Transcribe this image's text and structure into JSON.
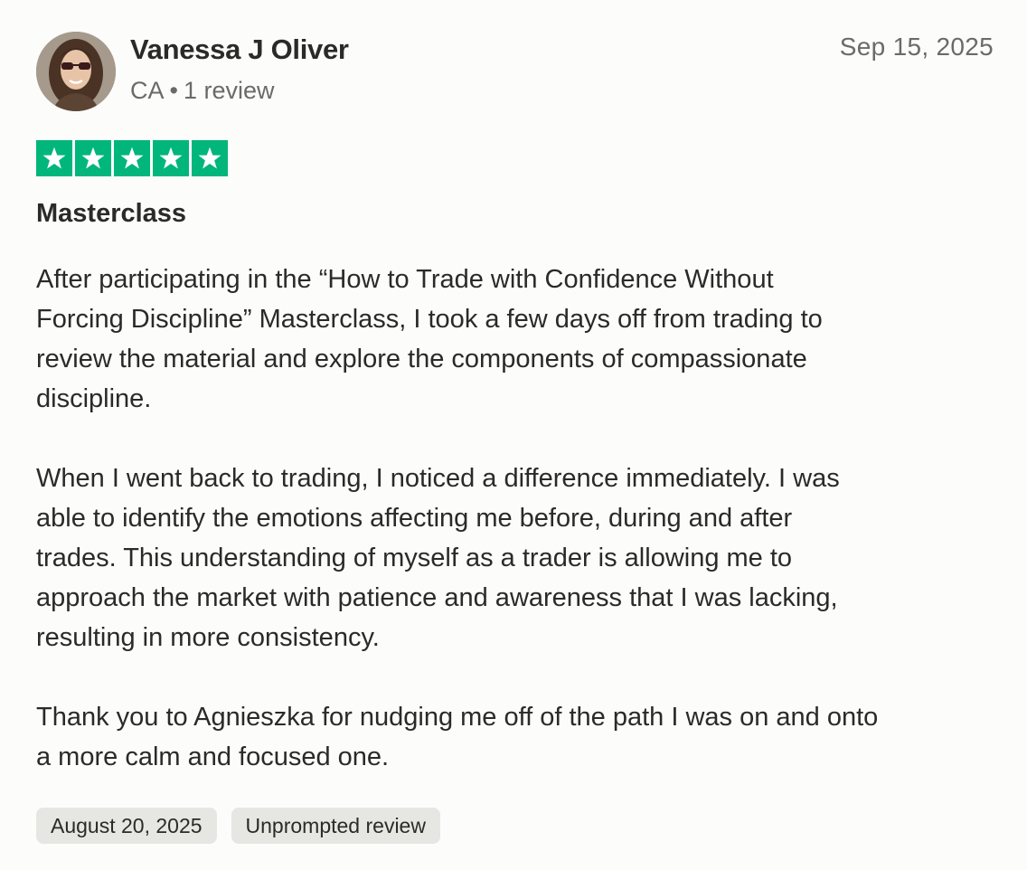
{
  "reviewer": {
    "name": "Vanessa J Oliver",
    "country": "CA",
    "separator": "•",
    "review_count": "1 review"
  },
  "review": {
    "posted_date": "Sep 15, 2025",
    "rating": 5,
    "rating_color": "#00b67a",
    "title": "Masterclass",
    "body": [
      [
        "After participating in the “How to Trade with Confidence Without",
        "Forcing Discipline” Masterclass, I took a few days off from trading to",
        "review the material and explore the components of compassionate",
        "discipline."
      ],
      [
        "When I went back to trading, I noticed a difference immediately. I was",
        "able to identify the emotions affecting me before, during and after",
        "trades. This understanding of myself as a trader is allowing me to",
        "approach the market with patience and awareness that I was lacking,",
        "resulting in more consistency."
      ],
      [
        "Thank you to Agnieszka for nudging me off of the path I was on and onto",
        "a more calm and focused one."
      ]
    ],
    "experience_date": "August 20, 2025",
    "badge": "Unprompted review"
  },
  "icons": {
    "avatar": "reviewer-photo",
    "star": "star-icon"
  }
}
